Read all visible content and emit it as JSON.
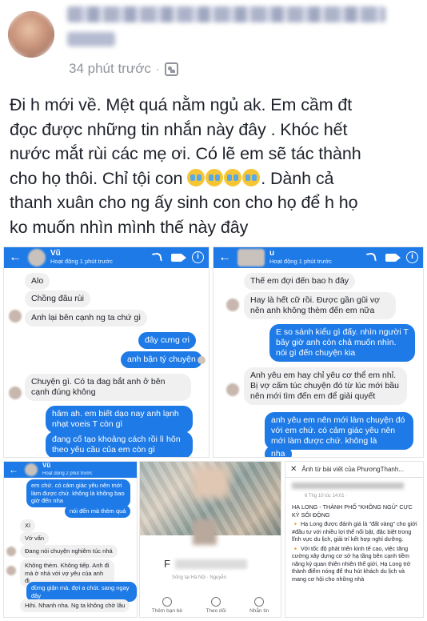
{
  "post": {
    "time": "34 phút trước",
    "dot": "·",
    "text": "Đi h mới về. Mệt quá nằm ngủ ak. Em cầm đt\nđọc được những tin nhắn này đây . Khóc hết\nnước mắt rùi các mẹ ơi. Có lẽ em sẽ tác thành\ncho họ thôi. Chỉ tội con ",
    "text_after_emoji": ". Dành cả\nthanh xuân cho ng ấy  sinh con cho họ để h họ\nko muốn nhìn mình thế này đây",
    "emoji_count": 4,
    "icon": "public-icon"
  },
  "shot1": {
    "name": "Vũ",
    "status": "Hoạt động 1 phút trước",
    "messages": [
      {
        "dir": "in",
        "text": "Alo"
      },
      {
        "dir": "in",
        "text": "Chồng đâu rùi"
      },
      {
        "dir": "in",
        "text": "Anh lại bên cạnh ng ta chứ gì"
      },
      {
        "dir": "out",
        "text": "đây cưng ơi"
      },
      {
        "dir": "out",
        "text": "anh bận tý chuyện"
      },
      {
        "dir": "in",
        "text": "Chuyện gì. Có ta đag bắt anh ở bên cạnh đúng không"
      },
      {
        "dir": "out",
        "text": "hâm ah. em biết dạo nay anh lạnh nhạt voeis T còn gì"
      },
      {
        "dir": "out",
        "text": "đang cố tạo khoảng cách rồi lì hôn theo yêu cầu của em còn gì"
      }
    ]
  },
  "shot2": {
    "name": "u",
    "status": "Hoạt động 1 phút trước",
    "messages": [
      {
        "dir": "in",
        "text": "Thế em đợi đến bao h đây"
      },
      {
        "dir": "in",
        "text": "Hay là hết cữ rồi. Được gần gũi vợ nên anh không thèm đến em nữa"
      },
      {
        "dir": "out",
        "text": "E so sánh kiểu gì đấy. nhìn người T bây giờ anh còn chả muốn nhìn. nói gì đến chuyện kia"
      },
      {
        "dir": "in",
        "text": "Anh yêu em hay chỉ yêu cơ thể em nhỉ. Bị vợ cấm túc chuyện đó từ lúc mới bầu nên mới tìm đến em để giải quyết"
      },
      {
        "dir": "out",
        "text": "anh yêu em nên mới làm chuyện đó với em chứ. có cảm giác yêu nên mới làm được chứ. không là"
      },
      {
        "dir": "out",
        "text": "nha"
      }
    ]
  },
  "shot3": {
    "name": "Vũ",
    "status": "Hoạt động 2 phút trước",
    "messages": [
      {
        "dir": "out",
        "text": "em chứ. có cảm giác yêu nên mới làm được chứ. không là không bao giờ đến nha"
      },
      {
        "dir": "out",
        "text": "nói đến mà thèm quá"
      },
      {
        "dir": "in",
        "text": "Xì"
      },
      {
        "dir": "in",
        "text": "Vớ vẩn"
      },
      {
        "dir": "in",
        "text": "Đang nói chuyện nghiêm túc nhá"
      },
      {
        "dir": "in",
        "text": "Không thèm. Không tiếp. Anh đi mà ở nhà với vợ yêu của anh đi"
      },
      {
        "dir": "out",
        "text": "đừng giận mà. đợi a chút. sang ngay đây"
      },
      {
        "dir": "in",
        "text": "Hihi. Nhanh nha. Ng ta không chờ lâu"
      }
    ]
  },
  "shot4": {
    "name_initial": "F",
    "sub": "Sống tại Hà Nội · Nguyễn",
    "actions": [
      "Thêm bạn bè",
      "Theo dõi",
      "Nhắn tin"
    ]
  },
  "shot5": {
    "bar_title": "Ảnh từ bài viết của PhươngThanh...",
    "close": "✕",
    "date": "6 Thg 10 lúc 14:01 · ",
    "body_lines": [
      "HẠ LONG - THÀNH PHỐ \"KHÔNG NGỦ\" CỰC KỲ SÔI ĐỘNG",
      "🔸 Hạ Long được đánh giá là \"đất vàng\" cho giới #đầu tư với nhiều lợi thế nổi bật, đặc biệt trong lĩnh vực du lịch, giải trí kết hợp nghỉ dưỡng.",
      "🔸 Với tốc độ phát triển kinh tế cao, việc tăng cường xây dựng cơ sở hạ tầng bên cạnh tiềm năng kỳ quan thiên nhiên thế giới, Hạ Long trở thành điểm nóng để thu hút khách du lịch và mang cơ hội cho những nhà"
    ]
  },
  "colors": {
    "messenger_blue": "#1e7ae6",
    "bubble_gray": "#f1f0f0",
    "meta_gray": "#90949c"
  }
}
